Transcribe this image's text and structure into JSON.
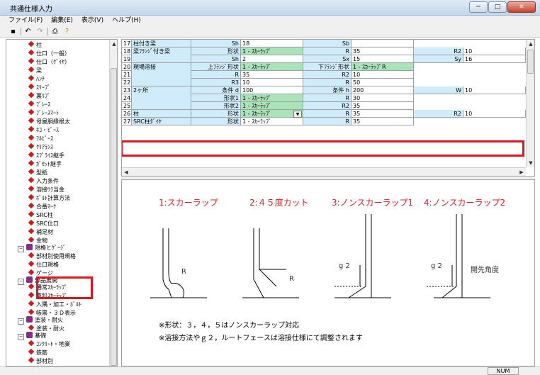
{
  "window": {
    "title": "共通仕様入力",
    "buttons": [
      "─",
      "□",
      "✕"
    ]
  },
  "menu": [
    "ファイル(F)",
    "編集(E)",
    "表示(V)",
    "ヘルプ(H)"
  ],
  "tree": [
    {
      "label": "柱",
      "type": "leaf",
      "indent": 1
    },
    {
      "label": "仕口（一般）",
      "type": "leaf",
      "indent": 1
    },
    {
      "label": "仕口（ｸﾞｲﾔ）",
      "type": "leaf",
      "indent": 1
    },
    {
      "label": "梁",
      "type": "leaf",
      "indent": 1
    },
    {
      "label": "ﾊﾝﾁ",
      "type": "leaf",
      "indent": 1
    },
    {
      "label": "ｽﾘｰﾌﾞ",
      "type": "leaf",
      "indent": 1
    },
    {
      "label": "裏ﾘﾌﾞ",
      "type": "leaf",
      "indent": 1
    },
    {
      "label": "ﾌﾞﾚｰｽ",
      "type": "leaf",
      "indent": 1
    },
    {
      "label": "ﾌﾞﾚｰｽﾏｰﾄ",
      "type": "leaf",
      "indent": 1
    },
    {
      "label": "母屋胴縁根太",
      "type": "leaf",
      "indent": 1
    },
    {
      "label": "ﾈｺ・ﾋﾟｰｽ",
      "type": "leaf",
      "indent": 1
    },
    {
      "label": "ﾌﾙﾋﾟｰｽ",
      "type": "leaf",
      "indent": 1
    },
    {
      "label": "ｸﾘｱﾗﾝｽ",
      "type": "leaf",
      "indent": 1
    },
    {
      "label": "ｽﾌﾟﾗｲｽ継手",
      "type": "leaf",
      "indent": 1
    },
    {
      "label": "ｶﾞｾｯﾄ継手",
      "type": "leaf",
      "indent": 1
    },
    {
      "label": "型紙",
      "type": "leaf",
      "indent": 1
    },
    {
      "label": "入力条件",
      "type": "leaf",
      "indent": 1
    },
    {
      "label": "溶接ｳﾗ当金",
      "type": "leaf",
      "indent": 1
    },
    {
      "label": "ﾎﾞﾙﾄ計算方法",
      "type": "leaf",
      "indent": 1
    },
    {
      "label": "合番ﾏｰｸ",
      "type": "leaf",
      "indent": 1
    },
    {
      "label": "SRC柱",
      "type": "leaf",
      "indent": 1
    },
    {
      "label": "SRC仕口",
      "type": "leaf",
      "indent": 1
    },
    {
      "label": "補足材",
      "type": "leaf",
      "indent": 1
    },
    {
      "label": "金物",
      "type": "leaf",
      "indent": 1
    },
    {
      "label": "規格とｹﾞｰｼﾞ",
      "type": "folder",
      "indent": 0
    },
    {
      "label": "部材別使用規格",
      "type": "leaf",
      "indent": 1
    },
    {
      "label": "仕口規格",
      "type": "leaf",
      "indent": 1
    },
    {
      "label": "ゲージ",
      "type": "leaf",
      "indent": 1
    },
    {
      "label": "部品展開",
      "type": "folder",
      "indent": 0
    },
    {
      "label": "通常ｽｶｰﾗｯﾌﾟ",
      "type": "leaf",
      "indent": 1
    },
    {
      "label": "重鉛ｽｶｰﾗｯﾌﾟ",
      "type": "leaf",
      "indent": 1
    },
    {
      "label": "入隅・加工・ﾎﾞﾙﾄ",
      "type": "leaf",
      "indent": 1
    },
    {
      "label": "帳票・３Ｄ表示",
      "type": "leaf",
      "indent": 1
    },
    {
      "label": "塗装・耐火",
      "type": "folder",
      "indent": 0
    },
    {
      "label": "塗装・耐火",
      "type": "leaf",
      "indent": 1
    },
    {
      "label": "基礎",
      "type": "folder",
      "indent": 0
    },
    {
      "label": "ｺﾝｸﾘｰﾄ・地業",
      "type": "leaf",
      "indent": 1
    },
    {
      "label": "鉄筋",
      "type": "leaf",
      "indent": 1
    },
    {
      "label": "部材別",
      "type": "leaf",
      "indent": 1
    }
  ],
  "grid": {
    "row_numbers": [
      "17",
      "18",
      "19",
      "20",
      "21",
      "22",
      "23",
      "24",
      "25",
      "26",
      "27"
    ],
    "groups": [
      "柱付き梁",
      "梁ﾌﾗﾝｼﾞ付き梁",
      "現場溶接",
      "2ヶ所",
      "柱",
      "SRC柱ﾀﾞｲﾔ"
    ],
    "labels": [
      "Sh",
      "Sb",
      "形状",
      "R",
      "R2",
      "Sh",
      "Sx",
      "Sy",
      "上ﾌﾗﾝｼﾞ形状",
      "下ﾌﾗﾝｼﾞ形状",
      "R",
      "R2",
      "R3",
      "R",
      "条件 d",
      "条件 h",
      "W",
      "形状1",
      "R",
      "形状2",
      "R2",
      "形状",
      "R",
      "R2",
      "形状",
      "R"
    ],
    "values": [
      "18",
      "",
      "1 - ｽｶｰﾗｯﾌﾟ",
      "35",
      "10",
      "2",
      "15",
      "16",
      "1 - ｽｶｰﾗｯﾌﾟ",
      "1 - ｽｶｰﾗｯﾌﾟR",
      "35",
      "10",
      "10",
      "50",
      "100",
      "200",
      "10",
      "1 - ｽｶｰﾗｯﾌﾟ",
      "30",
      "1 - ｽｶｰﾗｯﾌﾟ",
      "35",
      "1 - ｽｶｰﾗｯﾌﾟ",
      "35",
      "10",
      "1 - ｽｶｰﾗｯﾌﾟ",
      "35"
    ]
  },
  "diagram": {
    "titles": [
      "1:スカーラップ",
      "2:４５度カット",
      "3:ノンスカーラップ1",
      "4:ノンスカーラップ2"
    ],
    "labels": [
      "R",
      "R",
      "g 2",
      "g 2",
      "開先角度"
    ],
    "notes": [
      "※形状：３，４，５はノンスカーラップ対応",
      "※溶接方法やｇ２，ルートフェースは溶接仕様にて調整されます"
    ]
  },
  "status": {
    "num": "NUM"
  },
  "colors": {
    "accent_red": "#e0141e",
    "label_blue": "#d0ecfb",
    "value_green": "#a8e4b8",
    "diagram_red": "#d8202a"
  }
}
